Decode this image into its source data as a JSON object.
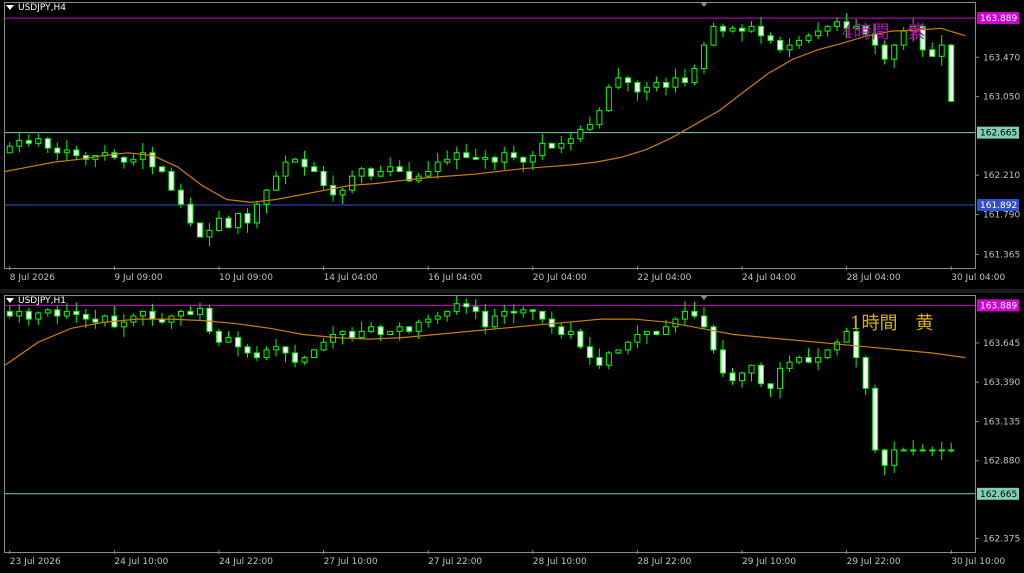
{
  "colors": {
    "bull": "#00ff00",
    "bull_fill": "#000000",
    "bear": "#00ff00",
    "bear_fill": "#ffffff",
    "ma": "#c87f0a",
    "magenta_line": "#d000d0",
    "cyan_line": "#7fd0b0",
    "blue_line": "#3050d0",
    "axis_text": "#c0c0c0",
    "note_h4": "#c000c0",
    "note_h1": "#d8b000"
  },
  "panes": [
    {
      "title": "USDJPY,H4",
      "note": "4時間　紫",
      "chart_data": {
        "type": "candlestick",
        "y_ticks": [
          "163.470",
          "163.050",
          "162.210",
          "161.790",
          "161.365"
        ],
        "y_tick_values": [
          163.47,
          163.05,
          162.21,
          161.79,
          161.365
        ],
        "ylim": [
          161.24,
          164.05
        ],
        "x_labels": [
          "8 Jul 2026",
          "9 Jul 09:00",
          "10 Jul 09:00",
          "14 Jul 04:00",
          "16 Jul 04:00",
          "20 Jul 04:00",
          "22 Jul 04:00",
          "24 Jul 04:00",
          "28 Jul 04:00",
          "30 Jul 04:00"
        ],
        "x_label_index": [
          0,
          11,
          22,
          33,
          44,
          55,
          66,
          77,
          88,
          99
        ],
        "hlines": [
          {
            "value": 163.889,
            "label": "163.889",
            "color": "#d000d0"
          },
          {
            "value": 162.665,
            "label": "162.665",
            "color": "#7fd0b0"
          },
          {
            "value": 161.892,
            "label": "161.892",
            "color": "#3050d0"
          }
        ],
        "seed": 4,
        "n": 101,
        "path": [
          162.45,
          162.52,
          162.58,
          162.55,
          162.6,
          162.5,
          162.45,
          162.48,
          162.42,
          162.38,
          162.42,
          162.45,
          162.4,
          162.35,
          162.38,
          162.45,
          162.3,
          162.25,
          162.05,
          161.9,
          161.7,
          161.55,
          161.62,
          161.75,
          161.65,
          161.8,
          161.7,
          161.9,
          162.05,
          162.2,
          162.35,
          162.38,
          162.3,
          162.25,
          162.1,
          162.0,
          162.05,
          162.2,
          162.28,
          162.2,
          162.25,
          162.3,
          162.25,
          162.15,
          162.2,
          162.25,
          162.35,
          162.38,
          162.45,
          162.4,
          162.38,
          162.4,
          162.35,
          162.45,
          162.4,
          162.35,
          162.42,
          162.55,
          162.5,
          162.55,
          162.6,
          162.7,
          162.75,
          162.9,
          163.15,
          163.25,
          163.2,
          163.1,
          163.15,
          163.2,
          163.15,
          163.25,
          163.2,
          163.35,
          163.6,
          163.8,
          163.75,
          163.78,
          163.75,
          163.8,
          163.7,
          163.65,
          163.55,
          163.6,
          163.65,
          163.7,
          163.75,
          163.8,
          163.85,
          163.78,
          163.8,
          163.72,
          163.6,
          163.45,
          163.6,
          163.75,
          163.8,
          163.55,
          163.48,
          163.6,
          163.0
        ],
        "ma": [
          162.25,
          162.3,
          162.35,
          162.38,
          162.42,
          162.45,
          162.42,
          162.3,
          162.1,
          161.95,
          161.92,
          161.95,
          162.0,
          162.05,
          162.1,
          162.12,
          162.15,
          162.18,
          162.2,
          162.22,
          162.25,
          162.28,
          162.3,
          162.32,
          162.35,
          162.4,
          162.48,
          162.6,
          162.75,
          162.9,
          163.1,
          163.3,
          163.45,
          163.55,
          163.62,
          163.7,
          163.75,
          163.76,
          163.78,
          163.7
        ]
      }
    },
    {
      "title": "USDJPY,H1",
      "note": "1時間　黄",
      "chart_data": {
        "type": "candlestick",
        "y_ticks": [
          "163.645",
          "163.390",
          "163.135",
          "162.880",
          "162.375"
        ],
        "y_tick_values": [
          163.645,
          163.39,
          163.135,
          162.88,
          162.375
        ],
        "ylim": [
          162.3,
          163.95
        ],
        "x_labels": [
          "23 Jul 2026",
          "24 Jul 10:00",
          "24 Jul 22:00",
          "27 Jul 10:00",
          "27 Jul 22:00",
          "28 Jul 10:00",
          "28 Jul 22:00",
          "29 Jul 10:00",
          "29 Jul 22:00",
          "30 Jul 10:00"
        ],
        "x_label_index": [
          0,
          11,
          22,
          33,
          44,
          55,
          66,
          77,
          88,
          99
        ],
        "hlines": [
          {
            "value": 163.889,
            "label": "163.889",
            "color": "#d000d0"
          },
          {
            "value": 162.665,
            "label": "162.665",
            "color": "#7fd0b0"
          }
        ],
        "seed": 9,
        "n": 101,
        "path": [
          163.85,
          163.82,
          163.85,
          163.8,
          163.84,
          163.86,
          163.82,
          163.85,
          163.83,
          163.8,
          163.78,
          163.82,
          163.75,
          163.78,
          163.82,
          163.85,
          163.8,
          163.78,
          163.82,
          163.85,
          163.83,
          163.87,
          163.72,
          163.65,
          163.68,
          163.62,
          163.58,
          163.55,
          163.6,
          163.62,
          163.58,
          163.52,
          163.55,
          163.6,
          163.65,
          163.7,
          163.72,
          163.68,
          163.72,
          163.75,
          163.7,
          163.72,
          163.75,
          163.72,
          163.78,
          163.8,
          163.82,
          163.85,
          163.9,
          163.88,
          163.85,
          163.75,
          163.82,
          163.85,
          163.84,
          163.86,
          163.85,
          163.8,
          163.75,
          163.7,
          163.72,
          163.62,
          163.55,
          163.5,
          163.58,
          163.6,
          163.65,
          163.7,
          163.72,
          163.7,
          163.75,
          163.8,
          163.85,
          163.82,
          163.75,
          163.6,
          163.45,
          163.4,
          163.45,
          163.5,
          163.38,
          163.35,
          163.48,
          163.52,
          163.55,
          163.52,
          163.55,
          163.6,
          163.65,
          163.72,
          163.55,
          163.35,
          162.95,
          162.85,
          162.95,
          162.95,
          162.95,
          162.95,
          162.95,
          162.95,
          162.95
        ],
        "ma": [
          163.5,
          163.65,
          163.74,
          163.78,
          163.8,
          163.8,
          163.79,
          163.77,
          163.74,
          163.7,
          163.68,
          163.67,
          163.68,
          163.7,
          163.72,
          163.74,
          163.76,
          163.78,
          163.8,
          163.8,
          163.78,
          163.74,
          163.7,
          163.68,
          163.66,
          163.64,
          163.62,
          163.6,
          163.58,
          163.55
        ]
      }
    }
  ]
}
